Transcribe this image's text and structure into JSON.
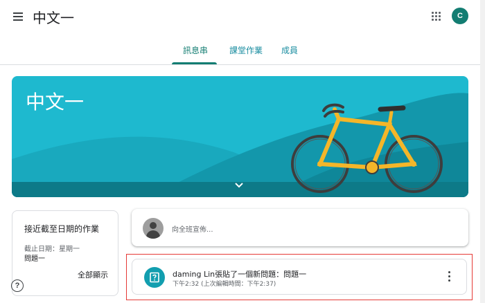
{
  "header": {
    "menu_icon": "hamburger-menu-icon",
    "title": "中文一",
    "apps_icon": "apps-grid-icon",
    "account_initial": "C",
    "account_color": "#137d72"
  },
  "tabs": [
    {
      "label": "訊息串",
      "active": true
    },
    {
      "label": "課堂作業",
      "active": false
    },
    {
      "label": "成員",
      "active": false
    }
  ],
  "banner": {
    "title": "中文一",
    "background_color": "#1eb9cf",
    "expand_icon": "chevron-down-icon"
  },
  "upcoming": {
    "title": "接近截至日期的作業",
    "due_label": "截止日期：星期一",
    "item": "問題一",
    "view_all": "全部顯示"
  },
  "help_icon": "help-circle-icon",
  "composer": {
    "placeholder": "向全班宣佈..."
  },
  "post": {
    "icon": "question-assignment-icon",
    "title": "daming Lin張貼了一個新問題：問題一",
    "time": "下午2:32 (上次編輯時間：下午2:37)",
    "more_icon": "more-vert-icon",
    "highlight_color": "#e53935"
  }
}
